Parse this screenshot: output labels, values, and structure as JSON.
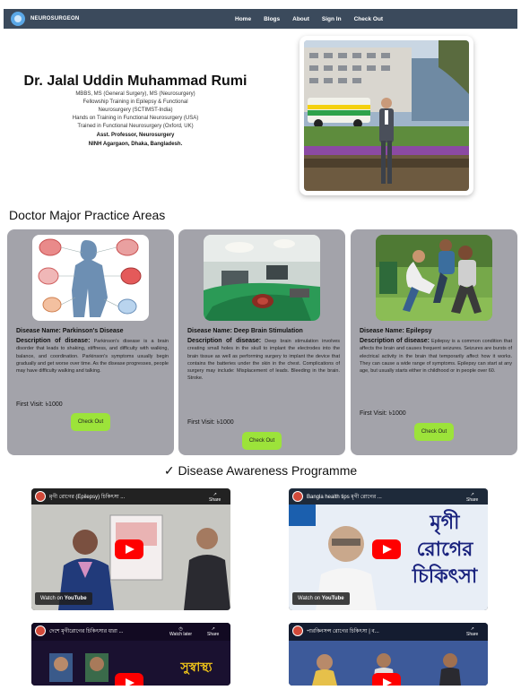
{
  "nav": {
    "brand": "NEUROSURGEON",
    "items": [
      "Home",
      "Blogs",
      "About",
      "Sign In",
      "Check Out"
    ]
  },
  "hero": {
    "name": "Dr. Jalal Uddin Muhammad Rumi",
    "credentials": [
      "MBBS, MS (General Surgery), MS (Neurosurgery)",
      "Fellowship Training in Epilepsy & Functional",
      "Neurosurgery (SCTIMST-India)",
      "Hands on Training in Functional Neurosurgery (USA)",
      "Trained in Functional Neurosurgery (Oxford, UK)"
    ],
    "position": "Asst. Professor, Neurosurgery",
    "institute": "NINH Agargaon, Dhaka, Bangladesh."
  },
  "practice": {
    "title": "Doctor Major Practice Areas",
    "name_label": "Disease Name:",
    "desc_label": "Description of disease:",
    "visit_label": "First Visit:",
    "button_label": "Check Out",
    "cards": [
      {
        "name": "Parkinson's Disease",
        "description": "Parkinson's disease is a brain disorder that leads to shaking, stiffness, and difficulty with walking, balance, and coordination. Parkinson's symptoms usually begin gradually and get worse over time. As the disease progresses, people may have difficulty walking and talking.",
        "visit": "৳1000"
      },
      {
        "name": "Deep Brain Stimulation",
        "description": "Deep brain stimulation involves creating small holes in the skull to implant the electrodes into the brain tissue as well as performing surgery to implant the device that contains the batteries under the skin in the chest. Complications of surgery may include: Misplacement of leads. Bleeding in the brain. Stroke.",
        "visit": "৳1000"
      },
      {
        "name": "Epilepsy",
        "description": "Epilepsy is a common condition that affects the brain and causes frequent seizures. Seizures are bursts of electrical activity in the brain that temporarily affect how it works. They can cause a wide range of symptoms. Epilepsy can start at any age, but usually starts either in childhood or in people over 60.",
        "visit": "৳1000"
      }
    ]
  },
  "awareness": {
    "title": "✓ Disease Awareness Programme",
    "videos": [
      {
        "title": "মৃগী রোগের (Epilepsy) চিকিৎসা ...",
        "watch": "Watch on",
        "yt": "YouTube",
        "share": "Share"
      },
      {
        "title": "Bangla health tips মৃগী রোগের ...",
        "watch": "Watch on",
        "yt": "YouTube",
        "share": "Share",
        "overlay": [
          "মৃগী",
          "রোগের",
          "চিকিৎসা"
        ]
      },
      {
        "title": "দেশে মৃগীরোগের চিকিৎসার ধারা ...",
        "later": "Watch later",
        "share": "Share",
        "overlay": [
          "সুস্বাস্থ্য"
        ]
      },
      {
        "title": "পারকিনসন্স রোগের চিকিৎসা | ব...",
        "share": "Share"
      }
    ]
  },
  "colors": {
    "nav_bg": "#3b4a5c",
    "card_bg": "#a3a3aa",
    "button_bg": "#9ce33a",
    "youtube_red": "#ff0000"
  }
}
